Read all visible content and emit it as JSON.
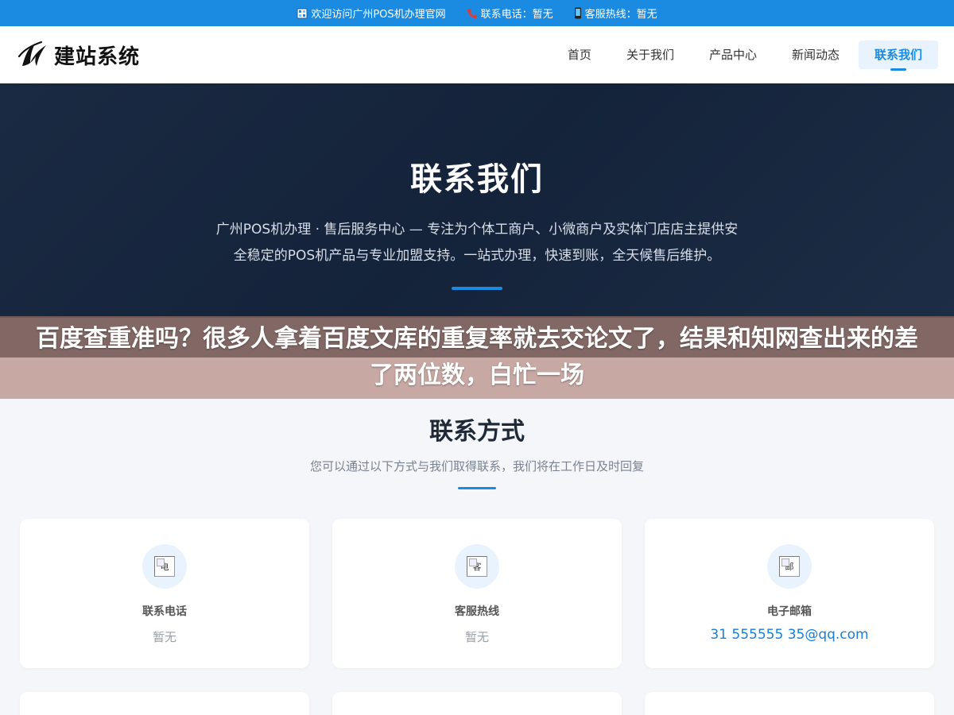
{
  "topbar": {
    "welcome": "欢迎访问广州POS机办理官网",
    "phone": "联系电话：暂无",
    "hotline": "客服热线：暂无"
  },
  "header": {
    "logo_text": "建站系统",
    "nav": [
      "首页",
      "关于我们",
      "产品中心",
      "新闻动态",
      "联系我们"
    ],
    "active_index": 4
  },
  "hero": {
    "title": "联系我们",
    "description": "广州POS机办理 · 售后服务中心 — 专注为个体工商户、小微商户及实体门店店主提供安全稳定的POS机产品与专业加盟支持。一站式办理，快速到账，全天候售后维护。"
  },
  "overlay": {
    "text": "百度查重准吗？很多人拿着百度文库的重复率就去交论文了，结果和知网查出来的差了两位数，白忙一场"
  },
  "contact": {
    "title": "联系方式",
    "subtitle": "您可以通过以下方式与我们取得联系，我们将在工作日及时回复",
    "cards": [
      {
        "icon_alt": "电",
        "label": "联系电话",
        "value": "暂无"
      },
      {
        "icon_alt": "客",
        "label": "客服热线",
        "value": "暂无"
      },
      {
        "icon_alt": "邮",
        "label": "电子邮箱",
        "value": "31 555555 35@qq.com"
      }
    ]
  },
  "colors": {
    "accent": "#1a8be0",
    "hero_bg": "#16263d",
    "email": "#1a7fd6"
  }
}
